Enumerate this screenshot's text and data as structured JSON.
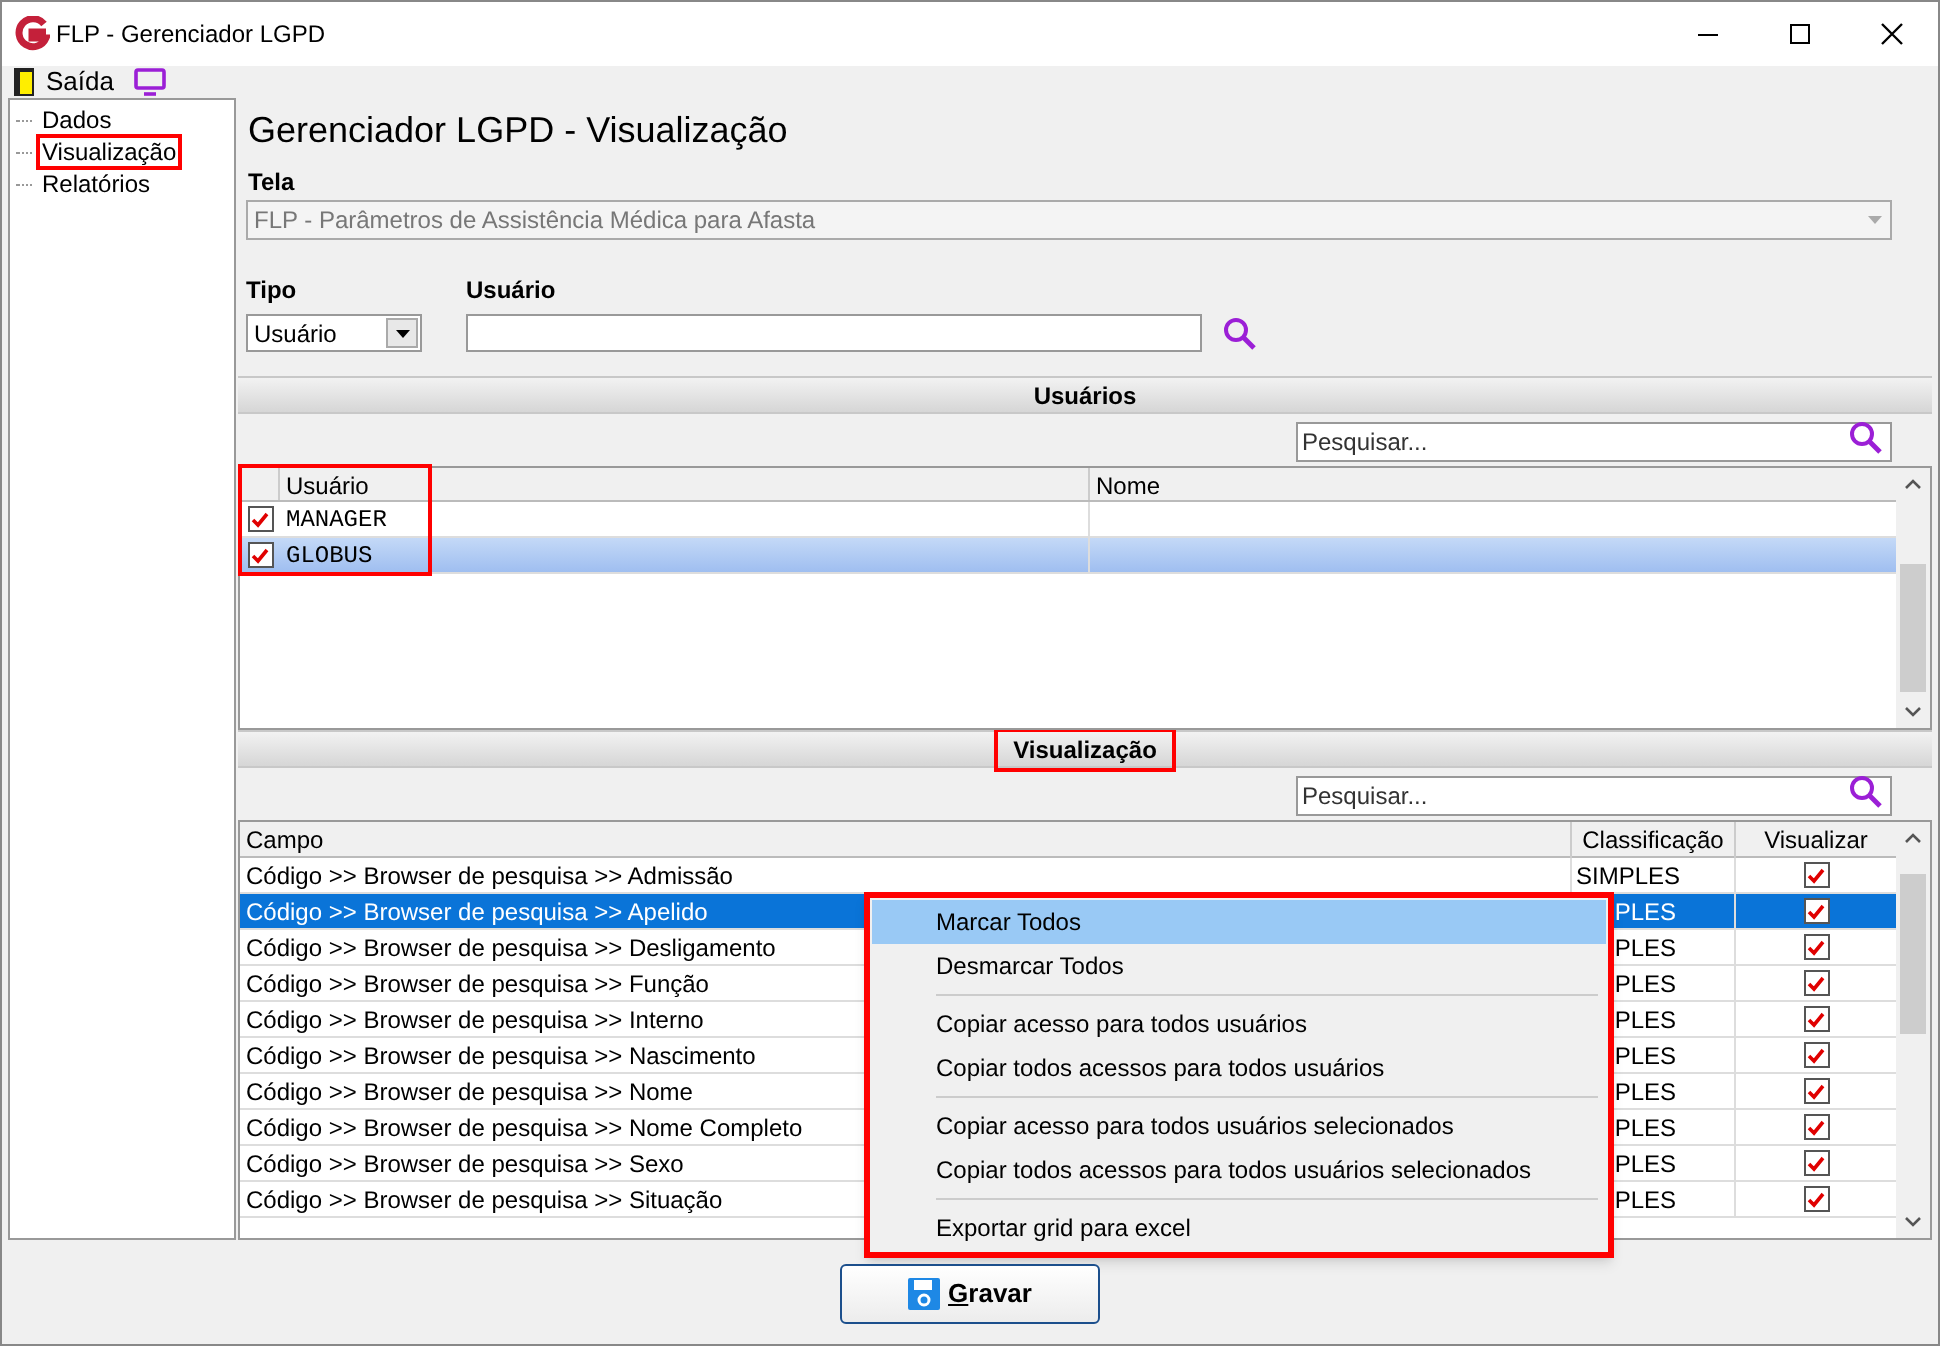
{
  "window": {
    "title": "FLP - Gerenciador LGPD"
  },
  "menu_bar": {
    "exit_label": "Saída"
  },
  "sidebar": {
    "items": [
      {
        "label": "Dados",
        "selected": false
      },
      {
        "label": "Visualização",
        "selected": true
      },
      {
        "label": "Relatórios",
        "selected": false
      }
    ]
  },
  "page_title": "Gerenciador LGPD - Visualização",
  "tela": {
    "label": "Tela",
    "value": "FLP - Parâmetros de Assistência Médica para Afasta",
    "disabled": true
  },
  "tipo": {
    "label": "Tipo",
    "value": "Usuário"
  },
  "usuario": {
    "label": "Usuário"
  },
  "users_section": {
    "title": "Usuários",
    "search_placeholder": "Pesquisar...",
    "columns": [
      "Usuário",
      "Nome"
    ],
    "rows": [
      {
        "user": "MANAGER",
        "checked": true,
        "selected": false
      },
      {
        "user": "GLOBUS",
        "checked": true,
        "selected": true
      }
    ]
  },
  "view_section": {
    "title": "Visualização",
    "search_placeholder": "Pesquisar...",
    "columns": [
      "Campo",
      "Classificação",
      "Visualizar"
    ],
    "rows": [
      {
        "field": "Código >> Browser de pesquisa >> Admissão",
        "classification": "SIMPLES",
        "checked": true,
        "selected": false
      },
      {
        "field": "Código >> Browser de pesquisa >> Apelido",
        "classification": "PLES",
        "checked": true,
        "selected": true
      },
      {
        "field": "Código >> Browser de pesquisa >> Desligamento",
        "classification": "PLES",
        "checked": true,
        "selected": false
      },
      {
        "field": "Código >> Browser de pesquisa >> Função",
        "classification": "PLES",
        "checked": true,
        "selected": false
      },
      {
        "field": "Código >> Browser de pesquisa >> Interno",
        "classification": "PLES",
        "checked": true,
        "selected": false
      },
      {
        "field": "Código >> Browser de pesquisa >> Nascimento",
        "classification": "PLES",
        "checked": true,
        "selected": false
      },
      {
        "field": "Código >> Browser de pesquisa >> Nome",
        "classification": "PLES",
        "checked": true,
        "selected": false
      },
      {
        "field": "Código >> Browser de pesquisa >> Nome Completo",
        "classification": "PLES",
        "checked": true,
        "selected": false
      },
      {
        "field": "Código >> Browser de pesquisa >> Sexo",
        "classification": "PLES",
        "checked": true,
        "selected": false
      },
      {
        "field": "Código >> Browser de pesquisa >> Situação",
        "classification": "PLES",
        "checked": true,
        "selected": false
      }
    ]
  },
  "context_menu": {
    "groups": [
      [
        {
          "label": "Marcar Todos",
          "selected": true
        },
        {
          "label": "Desmarcar Todos",
          "selected": false
        }
      ],
      [
        {
          "label": "Copiar acesso para todos usuários",
          "selected": false
        },
        {
          "label": "Copiar todos acessos para todos usuários",
          "selected": false
        }
      ],
      [
        {
          "label": "Copiar acesso para todos usuários selecionados",
          "selected": false
        },
        {
          "label": "Copiar todos acessos para todos usuários selecionados",
          "selected": false
        }
      ],
      [
        {
          "label": "Exportar grid para excel",
          "selected": false
        }
      ]
    ]
  },
  "save_button": {
    "mnemonic": "G",
    "rest": "ravar"
  }
}
